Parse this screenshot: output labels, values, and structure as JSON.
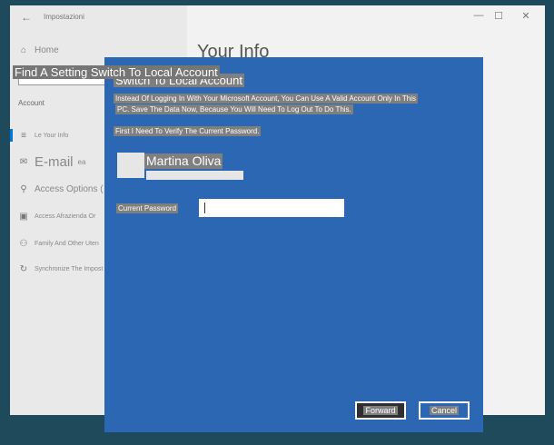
{
  "window": {
    "app_title": "Impostazioni",
    "back_icon": "back-arrow-icon",
    "controls": {
      "minimize": "—",
      "maximize": "☐",
      "close": "✕"
    }
  },
  "sidebar": {
    "home_icon": "home-icon",
    "home_label": "Home",
    "section_label": "Account",
    "items": [
      {
        "icon": "person-card-icon",
        "glyph": "≡",
        "label": "Le Your Info"
      },
      {
        "icon": "mail-icon",
        "glyph": "✉",
        "label": "E-mail",
        "suffix": "ea"
      },
      {
        "icon": "key-icon",
        "glyph": "⚲",
        "label": "Access Options ("
      },
      {
        "icon": "briefcase-icon",
        "glyph": "▣",
        "label": "Access Afrazienda Or"
      },
      {
        "icon": "people-icon",
        "glyph": "⚇",
        "label": "Family And Other Uten"
      },
      {
        "icon": "sync-icon",
        "glyph": "↻",
        "label": "Synchronize The Impost"
      }
    ]
  },
  "search": {
    "text": "Find A Setting Switch To Local Account"
  },
  "main": {
    "title": "Your Info"
  },
  "dialog": {
    "title": "Switch To Local Account",
    "paragraph1_line1": "Instead Of Logging In With Your Microsoft Account, You Can Use A Valid Account Only In This",
    "paragraph1_line2": "PC. Save The Data Now, Because You Will Need To Log Out To Do This.",
    "paragraph2": "First I Need To Verify The Current Password.",
    "user_name": "Martina Oliva",
    "password_label": "Current Password",
    "password_value": "",
    "forward_label": "Forward",
    "cancel_label": "Cancel"
  },
  "colors": {
    "dialog_bg": "#2b67b3",
    "highlight": "#7f7f7f",
    "desktop_bg": "#1f4a5c"
  }
}
